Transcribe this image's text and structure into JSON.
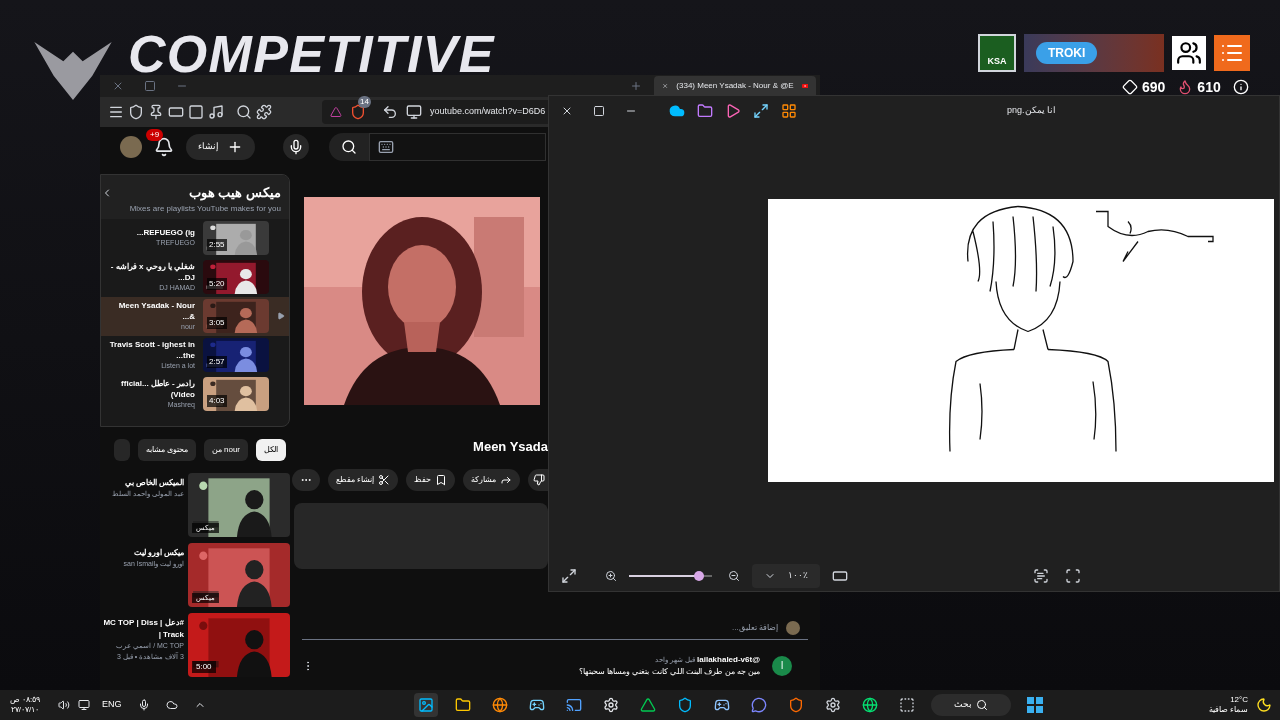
{
  "wallpaper": {
    "logo": "COMPETITIVE",
    "badges": [
      "KSA",
      "TROKI"
    ],
    "stats": [
      {
        "value": "610"
      },
      {
        "value": "690"
      }
    ]
  },
  "browser": {
    "tab_title": "(334) Meen Ysadak - Nour & @E",
    "url": "youtube.com/watch?v=D6D6",
    "extension_count": "14",
    "header": {
      "notification_count": "+9",
      "create_label": "إنشاء"
    },
    "playlist": {
      "title": "ميكس هيب هوب",
      "subtitle": "Mixes are playlists YouTube makes for you",
      "items": [
        {
          "title": "REFUEGO (ig...",
          "channel": "TREFUEGO",
          "duration": "2:55",
          "selected": false
        },
        {
          "title": "شغلي يا روحي x فراشه - DJ...",
          "channel": "DJ HAMAD",
          "duration": "5:20",
          "selected": false
        },
        {
          "title": "Meen Ysadak - Nour &...",
          "channel": "nour",
          "duration": "3:05",
          "selected": true
        },
        {
          "title": "Travis Scott - ighest in the...",
          "channel": "Listen a lot",
          "duration": "2:57",
          "selected": false
        },
        {
          "title": "رادمر - عاطل ...fficial Video)",
          "channel": "Mashreq",
          "duration": "4:03",
          "selected": false
        }
      ]
    },
    "chips": [
      {
        "label": "الكل",
        "selected": true
      },
      {
        "label": "من nour",
        "selected": false
      },
      {
        "label": "محتوى مشابه",
        "selected": false
      }
    ],
    "recommendations": [
      {
        "title": "الميكس الخاص بي",
        "lines": [
          "عبد المولى واحمد السلط"
        ],
        "badge": "ميكس"
      },
      {
        "title": "ميكس اورو ليت",
        "lines": [
          "اورو ليت وsan Ismail"
        ],
        "badge": "ميكس"
      },
      {
        "title": "#دعل | MC TOP | Diss Track |",
        "lines": [
          "MC TOP / اسمي عرب",
          "3 آلاف مشاهدة • قبل 3"
        ],
        "duration": "5:00"
      }
    ],
    "video": {
      "title": "Meen Ysada",
      "actions": [
        {
          "kind": "dislike"
        },
        {
          "kind": "share",
          "label": "مشاركة"
        },
        {
          "kind": "save",
          "label": "حفظ"
        },
        {
          "kind": "clip",
          "label": "إنشاء مقطع"
        },
        {
          "kind": "more"
        }
      ]
    },
    "comments": {
      "placeholder": "إضافة تعليق...",
      "items": [
        {
          "author": "@lailakhaled-v6t",
          "time": "قبل شهر واحد",
          "text": "مين جه من طرف البنت اللي كانت بتغني ومساها سحبتها؟",
          "avatar": "l"
        }
      ]
    }
  },
  "viewer": {
    "title": "انا يمكن.png",
    "zoom": "١٠٠٪",
    "level": 0.84
  },
  "taskbar": {
    "time": "٠٨:٥٩ ص",
    "date": "٢٧/٠٧/١٠",
    "language": "ENG",
    "search": "بحث",
    "temperature": "12°C",
    "weather": "سماء صافية"
  }
}
